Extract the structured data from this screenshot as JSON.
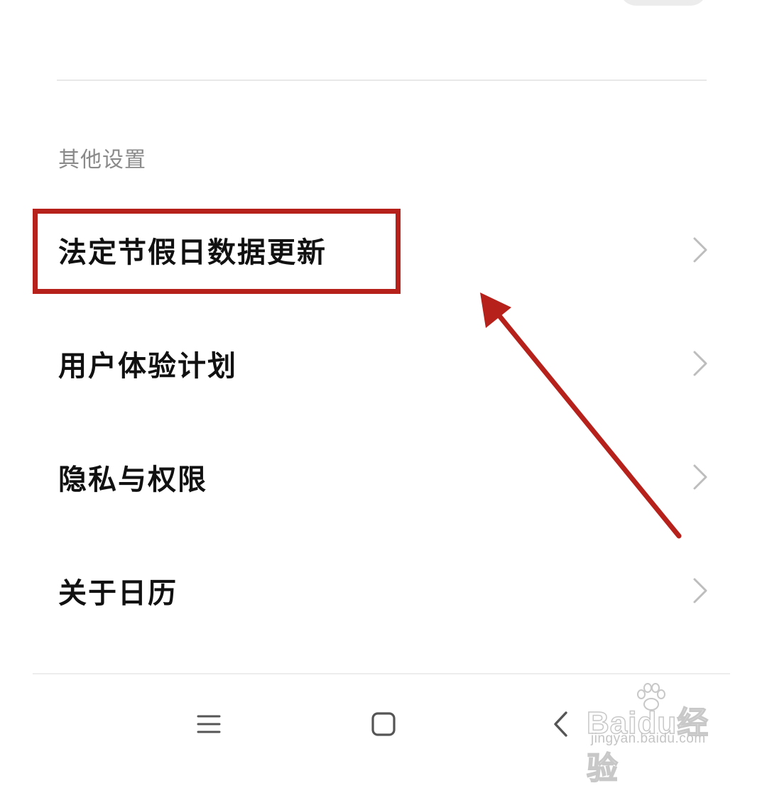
{
  "section_header": "其他设置",
  "rows": [
    {
      "label": "法定节假日数据更新"
    },
    {
      "label": "用户体验计划"
    },
    {
      "label": "隐私与权限"
    },
    {
      "label": "关于日历"
    }
  ],
  "icons": {
    "row_chevron": "chevron-right-icon",
    "nav_menu": "menu-icon",
    "nav_home": "home-square-icon",
    "nav_back": "back-chevron-icon"
  },
  "annotation": {
    "highlight_color": "#b7211b",
    "arrow_color": "#b7211b"
  },
  "watermark": {
    "brand": "Baidu经验",
    "url": "jingyan.baidu.com"
  }
}
